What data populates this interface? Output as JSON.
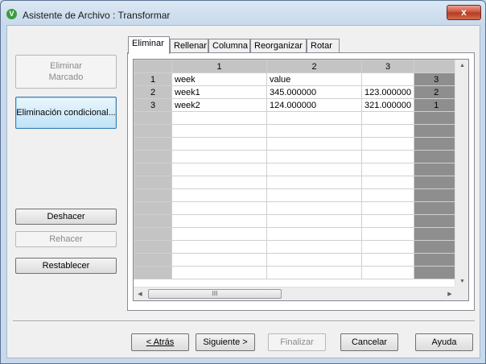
{
  "window": {
    "title": "Asistente de Archivo : Transformar",
    "icon": "V",
    "close_label": "x"
  },
  "sidebar": {
    "delete_marked": "Eliminar\nMarcado",
    "conditional_delete": "Eliminación condicional...",
    "undo": "Deshacer",
    "redo": "Rehacer",
    "reset": "Restablecer"
  },
  "tabs": [
    "Eliminar",
    "Rellenar",
    "Columna",
    "Reorganizar",
    "Rotar"
  ],
  "grid": {
    "col_headers": [
      "1",
      "2",
      "3"
    ],
    "rows": [
      {
        "num": "1",
        "c1": "week",
        "c2": "value",
        "c3": "",
        "c4": "3"
      },
      {
        "num": "2",
        "c1": "week1",
        "c2": "345.000000",
        "c3": "123.000000",
        "c4": "2"
      },
      {
        "num": "3",
        "c1": "week2",
        "c2": "124.000000",
        "c3": "321.000000",
        "c4": "1"
      }
    ],
    "empty_rows": 13,
    "scroll_glyph": "III"
  },
  "footer": {
    "back": "< Atrás",
    "next": "Siguiente >",
    "finish": "Finalizar",
    "cancel": "Cancelar",
    "help": "Ayuda"
  }
}
